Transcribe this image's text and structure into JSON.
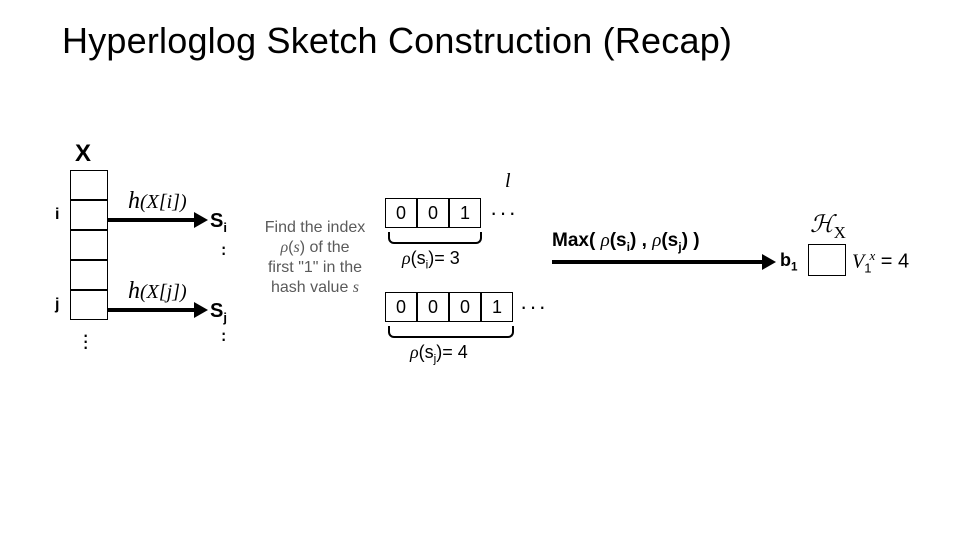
{
  "title": "Hyperloglog Sketch Construction (Recap)",
  "col": {
    "header": "X",
    "idx_i": "i",
    "idx_j": "j"
  },
  "hash": {
    "hi": "h(X[i])",
    "hj": "h(X[j])",
    "si_label": "Sᵢ",
    "sj_label": "Sⱼ"
  },
  "explain": {
    "line1": "Find the index",
    "line2": "ρ(s) of the",
    "line3": "first \"1\" in the",
    "line4": "hash value s"
  },
  "bits_i": [
    "0",
    "0",
    "1"
  ],
  "bits_j": [
    "0",
    "0",
    "0",
    "1"
  ],
  "ell": "l",
  "rho_i": "ρ(sᵢ)= 3",
  "rho_j": "ρ(sⱼ)= 4",
  "max": {
    "pre": "Max( ",
    "a": "ρ(sᵢ)",
    "mid": " , ",
    "b": "ρ(sⱼ)",
    "post": ")"
  },
  "out": {
    "b1": "b₁",
    "vx": "V₁ˣ",
    "eq": " = 4",
    "hx": "ℋ"
  }
}
